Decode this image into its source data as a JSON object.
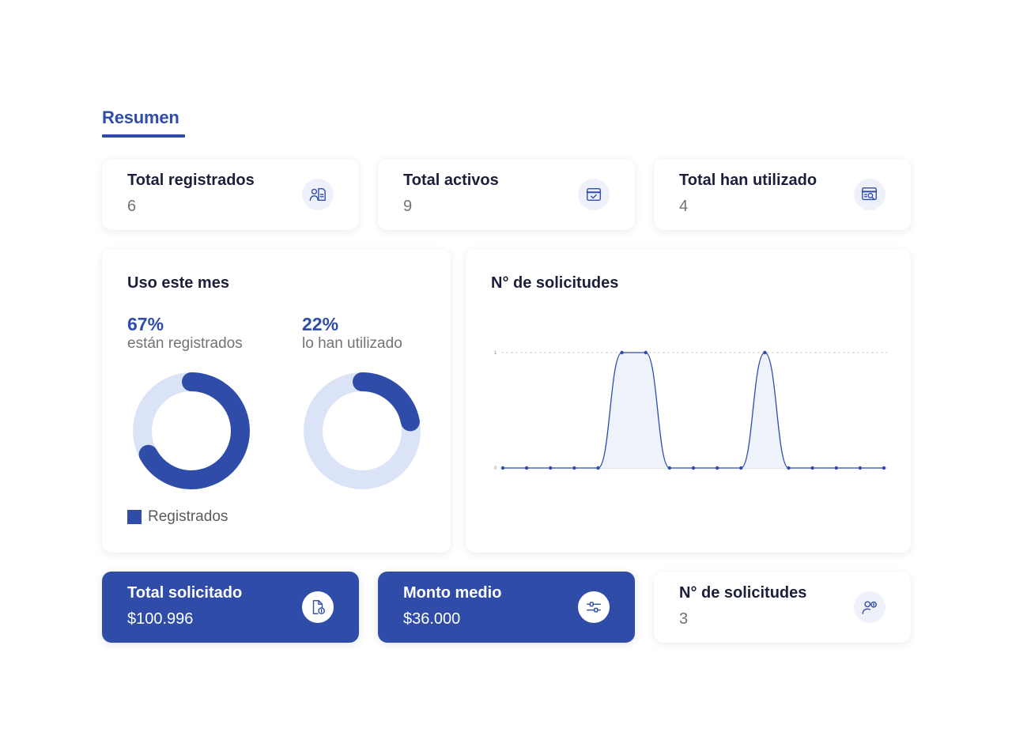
{
  "section": {
    "tab_label": "Resumen"
  },
  "top_cards": [
    {
      "title": "Total registrados",
      "value": "6",
      "icon": "user-document-icon"
    },
    {
      "title": "Total activos",
      "value": "9",
      "icon": "calendar-check-icon"
    },
    {
      "title": "Total han utilizado",
      "value": "4",
      "icon": "browser-search-icon"
    }
  ],
  "usage_panel": {
    "title": "Uso este mes",
    "registered": {
      "percent": "67%",
      "label": "están registrados",
      "fraction": 0.67
    },
    "used": {
      "percent": "22%",
      "label": "lo han utilizado",
      "fraction": 0.22
    },
    "legend": "Registrados",
    "colors": {
      "fill": "#2f4ca8",
      "track": "#dbe4f7"
    }
  },
  "requests_panel": {
    "title": "N° de solicitudes"
  },
  "chart_data": {
    "type": "area",
    "title": "N° de solicitudes",
    "xlabel": "",
    "ylabel": "",
    "x": [
      1,
      2,
      3,
      4,
      5,
      6,
      7,
      8,
      9,
      10,
      11,
      12,
      13,
      14,
      15,
      16,
      17
    ],
    "series": [
      {
        "values": [
          0,
          0,
          0,
          0,
          0,
          1,
          1,
          0,
          0,
          0,
          0,
          1,
          0,
          0,
          0,
          0,
          0
        ]
      }
    ],
    "y_ticks": [
      "0",
      "1"
    ],
    "ylim": [
      0,
      1
    ],
    "grid": "dashed line at y=1",
    "legend": "none",
    "colors": {
      "line": "#2f4ca8",
      "fill": "#eef2fb"
    }
  },
  "bottom_cards": [
    {
      "title": "Total solicitado",
      "value": "$100.996",
      "icon": "document-money-icon",
      "style": "blue"
    },
    {
      "title": "Monto medio",
      "value": "$36.000",
      "icon": "sliders-icon",
      "style": "blue"
    },
    {
      "title": "N° de solicitudes",
      "value": "3",
      "icon": "user-coin-icon",
      "style": "white"
    }
  ],
  "colors": {
    "accent": "#2f4ca8",
    "muted_text": "#737373",
    "heading_text": "#1b1f3b"
  }
}
